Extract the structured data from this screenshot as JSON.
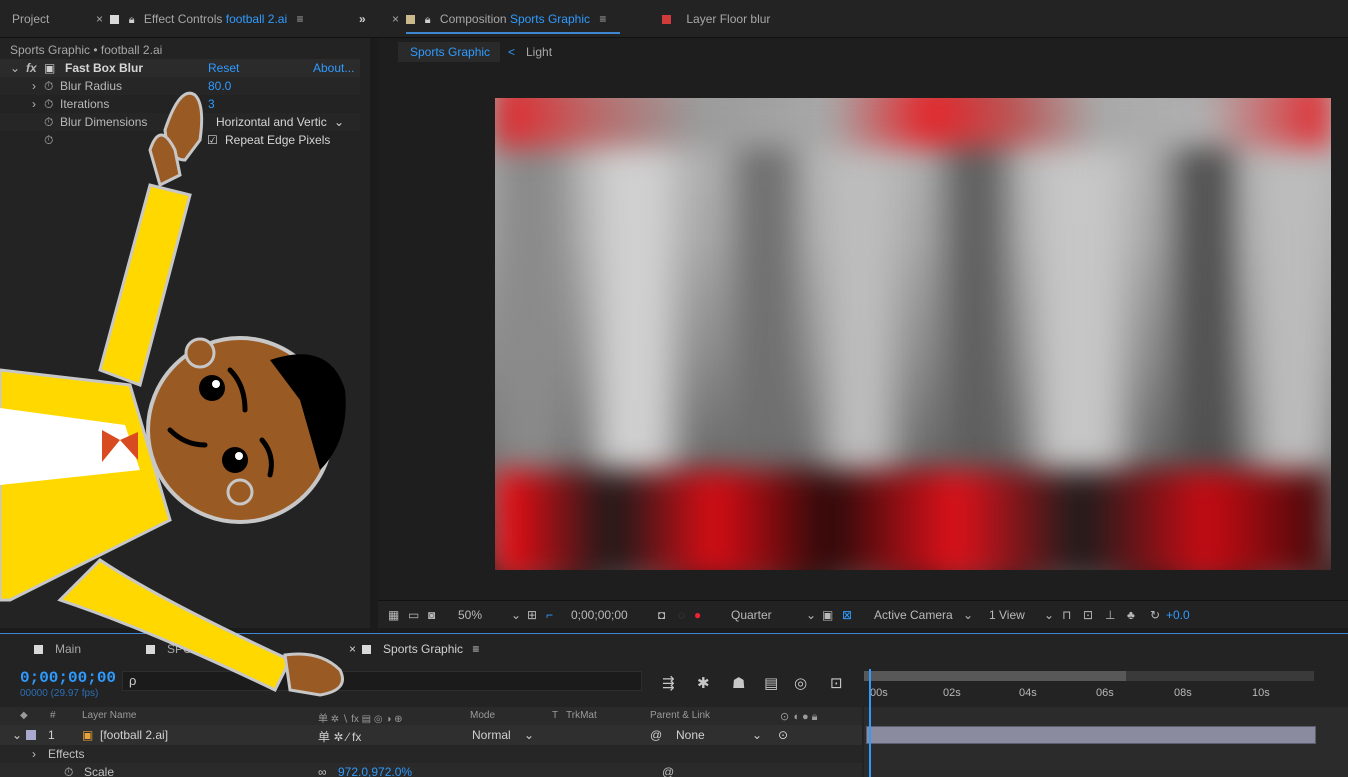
{
  "top_tabs": {
    "project": "Project",
    "effect_controls_prefix": "Effect Controls",
    "effect_controls_file": "football 2.ai",
    "composition_prefix": "Composition",
    "composition_name": "Sports Graphic",
    "layer_prefix": "Layer",
    "layer_name": "Floor blur",
    "menu_icon": "≡",
    "close_icon": "×",
    "expand_icon": "»"
  },
  "effect_controls": {
    "breadcrumb": "Sports Graphic • football 2.ai",
    "effect_name": "Fast Box Blur",
    "reset": "Reset",
    "about": "About...",
    "properties": [
      {
        "label": "Blur Radius",
        "value": "80.0"
      },
      {
        "label": "Iterations",
        "value": "3"
      },
      {
        "label": "Blur Dimensions",
        "value": "Horizontal and Vertic"
      },
      {
        "label": "",
        "value": "Repeat Edge Pixels"
      }
    ]
  },
  "viewer": {
    "crumbs": [
      "Sports Graphic",
      "Light"
    ],
    "crumb_arrow": "<",
    "zoom": "50%",
    "timecode": "0;00;00;00",
    "resolution": "Quarter",
    "camera": "Active Camera",
    "view": "1 View",
    "exposure": "+0.0",
    "dropdown_icon": "⌄"
  },
  "timeline": {
    "tabs": [
      "Main",
      "SPORTS LOGO",
      "Sports Graphic"
    ],
    "timecode": "0;00;00;00",
    "fps": "00000 (29.97 fps)",
    "search_icon": "ρ",
    "ruler_labels": [
      "00s",
      "02s",
      "04s",
      "06s",
      "08s",
      "10s"
    ],
    "columns": {
      "number": "#",
      "layer_name": "Layer Name",
      "switches": "单 ✲ ∖ fx ▤ ◎ ◑ ⊕",
      "mode": "Mode",
      "t": "T",
      "trkmat": "TrkMat",
      "parent": "Parent & Link"
    },
    "layer": {
      "index": "1",
      "name": "[football 2.ai]",
      "mode": "Normal",
      "parent": "None"
    },
    "sub_rows": [
      "Effects",
      "Scale"
    ],
    "scale_value": "972.0,972.0%"
  },
  "colors": {
    "accent_blue": "#2f9bff",
    "label_red": "#d13b3b",
    "shirt_yellow": "#ffd800",
    "skin_brown": "#9a5a23"
  }
}
